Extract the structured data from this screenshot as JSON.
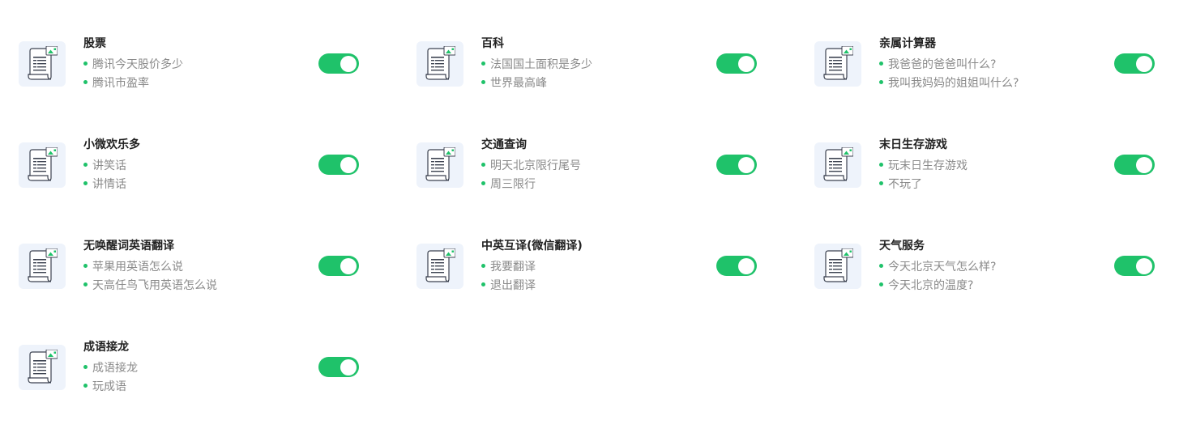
{
  "skills": [
    {
      "title": "股票",
      "examples": [
        "腾讯今天股价多少",
        "腾讯市盈率"
      ],
      "enabled": true
    },
    {
      "title": "百科",
      "examples": [
        "法国国土面积是多少",
        "世界最高峰"
      ],
      "enabled": true
    },
    {
      "title": "亲属计算器",
      "examples": [
        "我爸爸的爸爸叫什么?",
        "我叫我妈妈的姐姐叫什么?"
      ],
      "enabled": true
    },
    {
      "title": "小微欢乐多",
      "examples": [
        "讲笑话",
        "讲情话"
      ],
      "enabled": true
    },
    {
      "title": "交通查询",
      "examples": [
        "明天北京限行尾号",
        "周三限行"
      ],
      "enabled": true
    },
    {
      "title": "末日生存游戏",
      "examples": [
        "玩末日生存游戏",
        "不玩了"
      ],
      "enabled": true
    },
    {
      "title": "无唤醒词英语翻译",
      "examples": [
        "苹果用英语怎么说",
        "天高任鸟飞用英语怎么说"
      ],
      "enabled": true
    },
    {
      "title": "中英互译(微信翻译)",
      "examples": [
        "我要翻译",
        "退出翻译"
      ],
      "enabled": true
    },
    {
      "title": "天气服务",
      "examples": [
        "今天北京天气怎么样?",
        "今天北京的温度?"
      ],
      "enabled": true
    },
    {
      "title": "成语接龙",
      "examples": [
        "成语接龙",
        "玩成语"
      ],
      "enabled": true
    }
  ],
  "colors": {
    "accent": "#1fc26a",
    "icon_bg": "#eef3fb",
    "title_text": "#222222",
    "example_text": "#8a8a8a"
  },
  "icon": "document-scroll-icon"
}
